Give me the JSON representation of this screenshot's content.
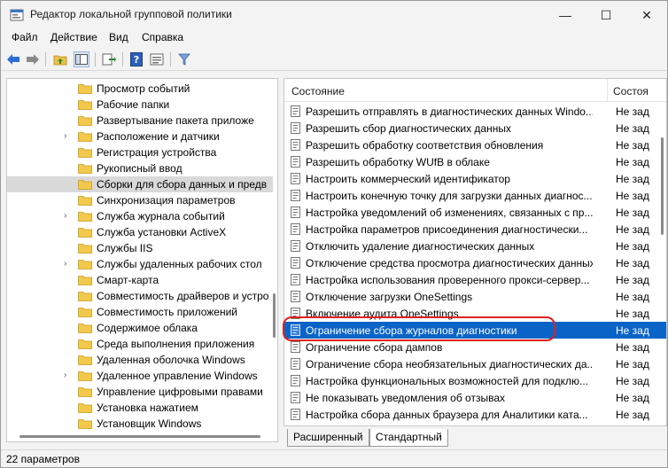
{
  "window": {
    "title": "Редактор локальной групповой политики",
    "minimize": "—",
    "maximize": "☐",
    "close": "✕"
  },
  "menu": [
    "Файл",
    "Действие",
    "Вид",
    "Справка"
  ],
  "toolbar": {
    "icons": [
      "back-arrow-icon",
      "forward-arrow-icon",
      "up-folder-icon",
      "show-tree-icon",
      "export-list-icon",
      "help-icon",
      "properties-icon",
      "filter-icon"
    ]
  },
  "tree": {
    "items": [
      {
        "label": "Просмотр событий",
        "expandable": false
      },
      {
        "label": "Рабочие папки",
        "expandable": false
      },
      {
        "label": "Развертывание пакета приложе",
        "expandable": false
      },
      {
        "label": "Расположение и датчики",
        "expandable": true
      },
      {
        "label": "Регистрация устройства",
        "expandable": false
      },
      {
        "label": "Рукописный ввод",
        "expandable": false
      },
      {
        "label": "Сборки для сбора данных и предв",
        "expandable": false,
        "selected": true
      },
      {
        "label": "Синхронизация параметров",
        "expandable": false
      },
      {
        "label": "Служба журнала событий",
        "expandable": true
      },
      {
        "label": "Служба установки ActiveX",
        "expandable": false
      },
      {
        "label": "Службы IIS",
        "expandable": false
      },
      {
        "label": "Службы удаленных рабочих стол",
        "expandable": true
      },
      {
        "label": "Смарт-карта",
        "expandable": false
      },
      {
        "label": "Совместимость драйверов и устро",
        "expandable": false
      },
      {
        "label": "Совместимость приложений",
        "expandable": false
      },
      {
        "label": "Содержимое облака",
        "expandable": false
      },
      {
        "label": "Среда выполнения приложения",
        "expandable": false
      },
      {
        "label": "Удаленная оболочка Windows",
        "expandable": false
      },
      {
        "label": "Удаленное управление Windows",
        "expandable": true
      },
      {
        "label": "Управление цифровыми правами",
        "expandable": false
      },
      {
        "label": "Установка нажатием",
        "expandable": false
      },
      {
        "label": "Установщик Windows",
        "expandable": false
      }
    ]
  },
  "list": {
    "columns": [
      "Состояние",
      "Состоя"
    ],
    "rows": [
      {
        "name": "Разрешить отправлять в диагностических данных Windo...",
        "state": "Не зад"
      },
      {
        "name": "Разрешить сбор диагностических данных",
        "state": "Не зад"
      },
      {
        "name": "Разрешить обработку соответствия обновления",
        "state": "Не зад"
      },
      {
        "name": "Разрешить обработку WUfB в облаке",
        "state": "Не зад"
      },
      {
        "name": "Настроить коммерческий идентификатор",
        "state": "Не зад"
      },
      {
        "name": "Настроить конечную точку для загрузки данных диагнос...",
        "state": "Не зад"
      },
      {
        "name": "Настройка уведомлений об изменениях, связанных с пр...",
        "state": "Не зад"
      },
      {
        "name": "Настройка параметров присоединения диагностически...",
        "state": "Не зад"
      },
      {
        "name": "Отключить удаление диагностических данных",
        "state": "Не зад"
      },
      {
        "name": "Отключение средства просмотра диагностических данных",
        "state": "Не зад"
      },
      {
        "name": "Настройка использования проверенного прокси-сервер...",
        "state": "Не зад"
      },
      {
        "name": "Отключение загрузки OneSettings",
        "state": "Не зад"
      },
      {
        "name": "Включение аудита OneSettings",
        "state": "Не зад"
      },
      {
        "name": "Ограничение сбора журналов диагностики",
        "state": "Не зад",
        "selected": true
      },
      {
        "name": "Ограничение сбора дампов",
        "state": "Не зад"
      },
      {
        "name": "Ограничение сбора необязательных диагностических да...",
        "state": "Не зад"
      },
      {
        "name": "Настройка функциональных возможностей для подклю...",
        "state": "Не зад"
      },
      {
        "name": "Не показывать уведомления об отзывах",
        "state": "Не зад"
      },
      {
        "name": "Настройка сбора данных браузера для Аналитики ката...",
        "state": "Не зад"
      }
    ]
  },
  "tabs": [
    "Расширенный",
    "Стандартный"
  ],
  "status": "22 параметров",
  "colors": {
    "selection": "#0a64c8",
    "highlight_ring": "#e02020",
    "folder": "#f2c94c"
  }
}
